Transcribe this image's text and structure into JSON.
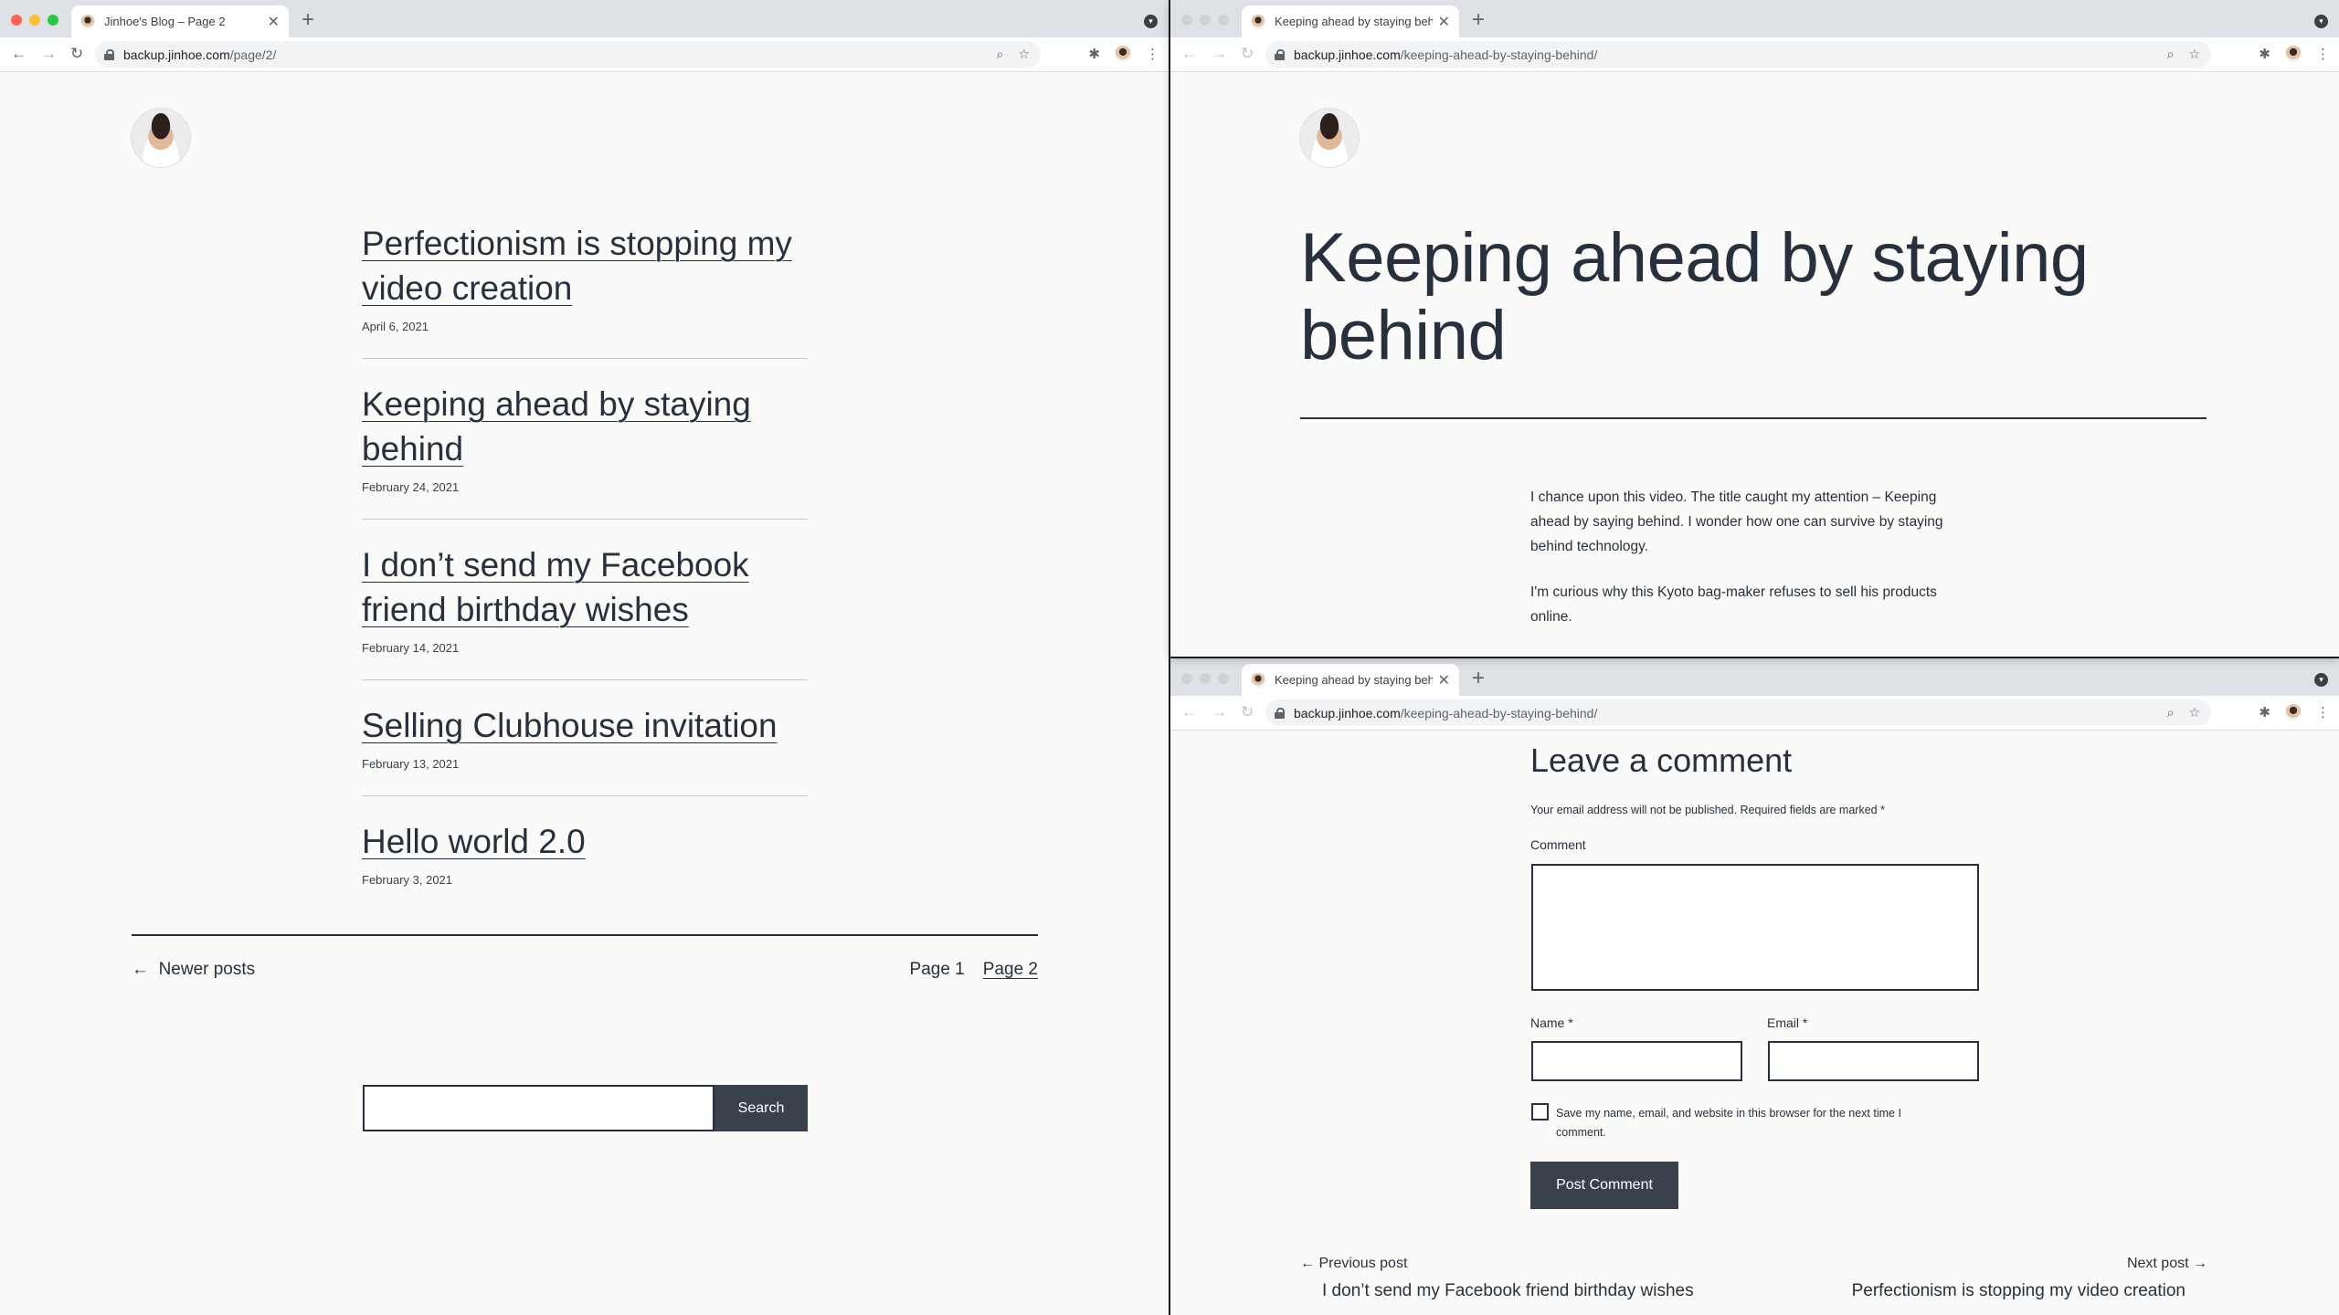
{
  "left": {
    "tab_title": "Jinhoe's Blog – Page 2",
    "url_host": "backup.jinhoe.com",
    "url_path": "/page/2/",
    "posts": [
      {
        "title_lines": [
          "Perfectionism is stopping my",
          "video creation"
        ],
        "date": "April 6, 2021"
      },
      {
        "title_lines": [
          "Keeping ahead by staying",
          "behind"
        ],
        "date": "February 24, 2021"
      },
      {
        "title_lines": [
          "I don’t send my Facebook",
          "friend birthday wishes"
        ],
        "date": "February 14, 2021"
      },
      {
        "title_lines": [
          "Selling Clubhouse invitation"
        ],
        "date": "February 13, 2021"
      },
      {
        "title_lines": [
          "Hello world 2.0"
        ],
        "date": "February 3, 2021"
      }
    ],
    "newer_posts": "Newer posts",
    "page1": "Page 1",
    "page2": "Page 2",
    "search_button": "Search"
  },
  "top_right": {
    "tab_title": "Keeping ahead by staying beh",
    "url_host": "backup.jinhoe.com",
    "url_path": "/keeping-ahead-by-staying-behind/",
    "title_lines": [
      "Keeping ahead by staying",
      "behind"
    ],
    "paragraphs": [
      [
        "I chance upon this video. The title caught my attention – Keeping",
        "ahead by saying behind. I wonder how one can survive by staying",
        "behind technology."
      ],
      [
        "I'm curious why this Kyoto bag-maker refuses to sell his products",
        "online."
      ]
    ]
  },
  "bottom_right": {
    "tab_title": "Keeping ahead by staying beh",
    "url_host": "backup.jinhoe.com",
    "url_path": "/keeping-ahead-by-staying-behind/",
    "leave_comment": "Leave a comment",
    "note": "Your email address will not be published. Required fields are marked *",
    "comment_label": "Comment",
    "name_label": "Name *",
    "email_label": "Email *",
    "save_lines": [
      "Save my name, email, and website in this browser for the next time I",
      "comment."
    ],
    "post_comment": "Post Comment",
    "previous_label": "Previous post",
    "previous_title": "I don’t send my Facebook friend birthday wishes",
    "next_label": "Next post",
    "next_title": "Perfectionism is stopping my video creation"
  }
}
